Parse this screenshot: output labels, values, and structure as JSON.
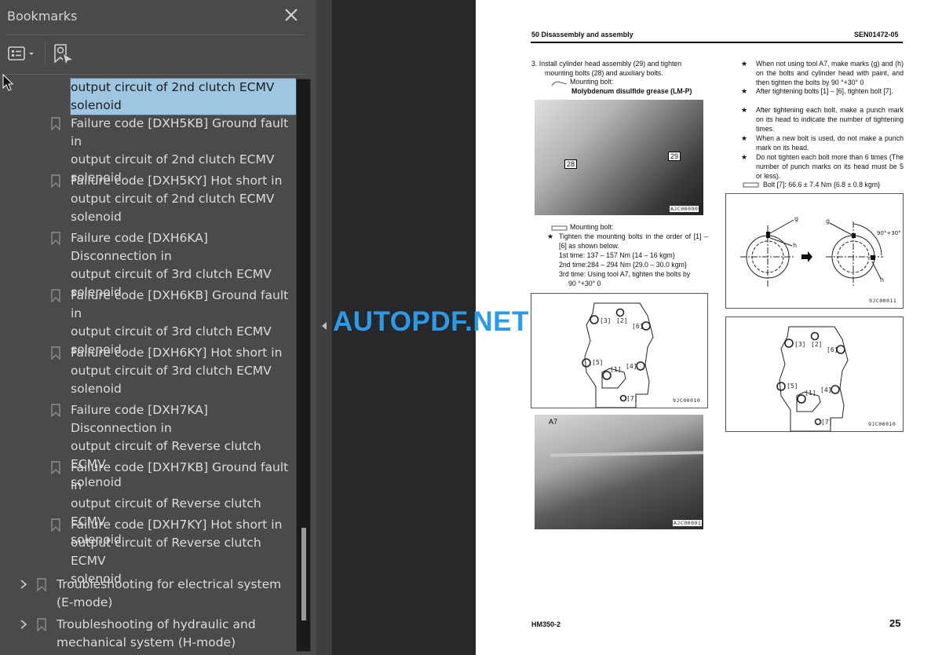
{
  "sidebar": {
    "title": "Bookmarks",
    "close_icon": "close-icon",
    "toolbar": {
      "options_icon": "list-options-icon",
      "find_bookmark_icon": "bookmark-find-icon"
    },
    "items": [
      {
        "label": "output circuit of 2nd clutch ECMV\nsolenoid",
        "selected": true,
        "level": 2
      },
      {
        "label": "Failure code [DXH5KB] Ground fault in\noutput circuit of 2nd clutch ECMV\nsolenoid",
        "level": 2
      },
      {
        "label": "Failure code [DXH5KY] Hot short in\noutput circuit of 2nd clutch ECMV\nsolenoid",
        "level": 2
      },
      {
        "label": "Failure code [DXH6KA] Disconnection in\noutput circuit of 3rd clutch ECMV\nsolenoid",
        "level": 2
      },
      {
        "label": "Failure code [DXH6KB] Ground fault in\noutput circuit of 3rd clutch ECMV\nsolenoid",
        "level": 2
      },
      {
        "label": "Failure code [DXH6KY] Hot short in\noutput circuit of 3rd clutch ECMV\nsolenoid",
        "level": 2
      },
      {
        "label": "Failure code [DXH7KA] Disconnection in\noutput circuit of Reverse clutch ECMV\nsolenoid",
        "level": 2
      },
      {
        "label": "Failure code [DXH7KB] Ground fault in\noutput circuit of Reverse clutch ECMV\nsolenoid",
        "level": 2
      },
      {
        "label": "Failure code [DXH7KY] Hot short in\noutput circuit of Reverse clutch ECMV\nsolenoid",
        "level": 2
      },
      {
        "label": "Troubleshooting for electrical system\n(E-mode)",
        "level": 1,
        "expandable": true
      },
      {
        "label": "Troubleshooting of hydraulic and\nmechanical system (H-mode)",
        "level": 1,
        "expandable": true
      }
    ]
  },
  "watermark": "AUTOPDF.NET",
  "page": {
    "header_left": "50 Disassembly and assembly",
    "header_right": "SEN01472-05",
    "step3": {
      "line1": "3.   Install cylinder head assembly (29) and tighten",
      "line2": "mounting bolts (28) and auxiliary bolts.",
      "grease_label": "Mounting bolt:",
      "grease_name": "Molybdenum disulfide grease (LM-P)"
    },
    "photo1": {
      "caption": "AJC00090",
      "callouts": [
        "28",
        "29"
      ]
    },
    "torque_block": {
      "label": "Mounting bolt:",
      "note": "Tighten the mounting bolts in the order of [1] – [6] as shown below.",
      "first": "1st time: 137 – 157 Nm {14 – 16 kgm}",
      "second": "2nd time:284 – 294 Nm {29.0 – 30.0 kgm}",
      "third": "3rd time: Using tool A7, tighten the bolts by",
      "third_angle": "90 °+30° 0"
    },
    "diagram_bolt_order": {
      "caption": "9JC00010",
      "labels": [
        "[1]",
        "[2]",
        "[3]",
        "[4]",
        "[5]",
        "[6]",
        "[7]"
      ]
    },
    "photo2": {
      "caption": "AJC00091",
      "callout": "A7"
    },
    "right_notes": [
      "When not using tool A7, make marks (g) and (h) on the bolts and cylinder head with paint, and then tighten the bolts by 90 °+30° 0",
      "After tightening bolts [1] – [6], tighten bolt [7].",
      "After tightening each bolt, make a punch mark on its head to indicate the number of tightening times.",
      "When a new bolt is used, do not make a punch mark on its head.",
      "Do not tighten each bolt more than 6 times (The number of punch marks on its head must be 5 or less)."
    ],
    "bolt7_torque": "Bolt [7]: 66.6 ± 7.4 Nm {6.8 ± 0.8 kgm}",
    "diagram_marks": {
      "caption": "9JC00011",
      "labels": [
        "g",
        "h",
        "g",
        "h",
        "90°+30° 0"
      ]
    },
    "diagram_bolt_order2": {
      "caption": "9JC00010"
    },
    "footer_left": "HM350-2",
    "page_number": "25"
  }
}
